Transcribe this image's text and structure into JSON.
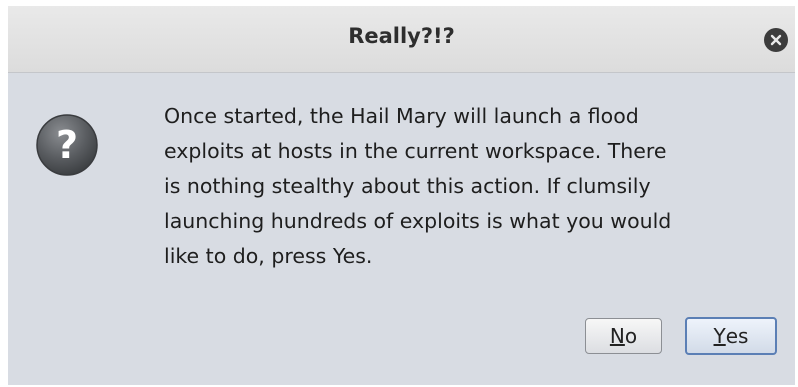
{
  "dialog": {
    "title": "Really?!?",
    "message": "Once started, the Hail Mary will launch a flood\nexploits at hosts in the current workspace. There\nis nothing stealthy about this action. If clumsily\nlaunching hundreds of exploits is what you would\nlike to do, press Yes.",
    "icon": "question-icon",
    "close_icon": "close-icon"
  },
  "buttons": {
    "no": {
      "mnemonic": "N",
      "rest": "o"
    },
    "yes": {
      "mnemonic": "Y",
      "rest": "es"
    }
  },
  "colors": {
    "background": "#d8dce3",
    "titlebar": "#e2e2e2",
    "default_button_border": "#5b7fb5"
  }
}
